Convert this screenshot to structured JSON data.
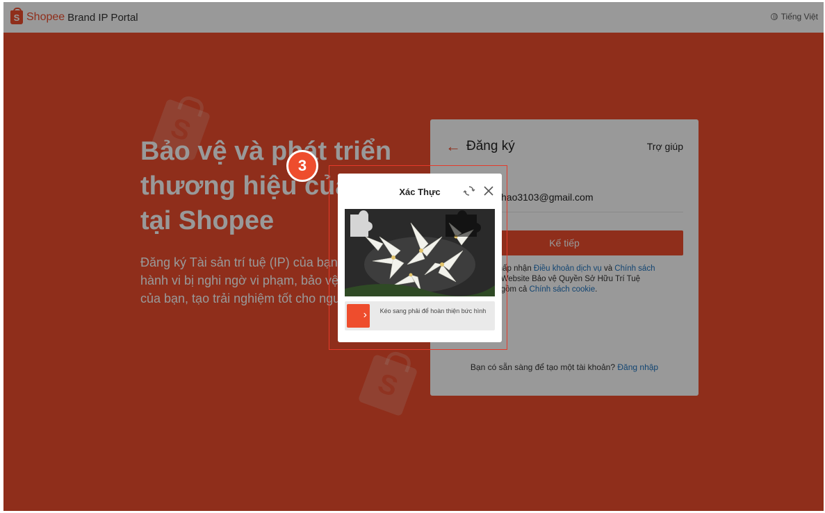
{
  "header": {
    "logo_letter": "S",
    "logo_text": "Shopee",
    "portal_name": "Brand IP Portal",
    "language": "Tiếng Việt",
    "icons": {
      "logo": "shopee-bag-icon",
      "language": "globe-icon"
    }
  },
  "hero": {
    "title": "Bảo vệ và phát triển thương hiệu của bạn tại Shopee",
    "description": "Đăng ký Tài sản trí tuệ (IP) của bạn để báo cáo các hành vi bị nghi ngờ vi phạm, bảo vệ thương hiệu của bạn, tạo trải nghiệm tốt cho người dùng."
  },
  "register_card": {
    "title": "Đăng ký",
    "help": "Trợ giúp",
    "email_value": "hao3103@gmail.com",
    "next_button": "Kế tiếp",
    "terms_prefix": "chấp nhận",
    "terms_link1": "Điều khoản dịch vụ",
    "terms_and": "và",
    "terms_link2": "Chính sách",
    "terms_mid": "a Website Bảo vệ Quyền Sở Hữu Trí Tuệ",
    "terms_mid2": "o gồm cả",
    "terms_link3": "Chính sách cookie",
    "terms_end": ".",
    "login_prompt": "Bạn có sẵn sàng để tạo một tài khoản?",
    "login_link": "Đăng nhập",
    "icons": {
      "back": "back-arrow-icon"
    }
  },
  "captcha": {
    "title": "Xác Thực",
    "slider_hint": "Kéo sang phải để hoàn thiện bức hình",
    "icons": {
      "refresh": "refresh-icon",
      "close": "close-icon",
      "slider": "slider-arrow-icon"
    }
  },
  "annotation": {
    "step_number": "3"
  },
  "colors": {
    "brand": "#ee4d2d",
    "link": "#1e73be",
    "annotation": "#e53a2a"
  }
}
